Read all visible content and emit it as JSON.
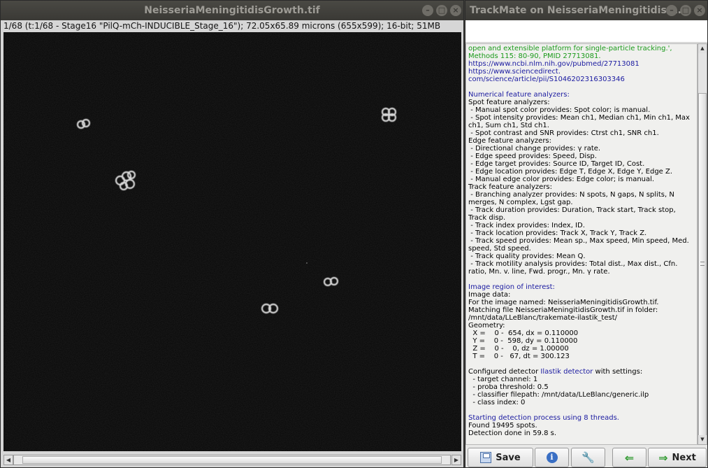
{
  "image_window": {
    "title": "NeisseriaMeningitidisGrowth.tif",
    "info": "1/68 (t:1/68 - Stage16 \"PilQ-mCh-INDUCIBLE_Stage_16\"); 72.05x65.89 microns (655x599); 16-bit; 51MB"
  },
  "trackmate_window": {
    "title": "TrackMate on NeisseriaMeningitidisG…",
    "log": [
      {
        "text": "open and extensible platform for single-particle tracking.', Methods 115: 80-90, PMID 27713081.",
        "color": "green"
      },
      {
        "text": "https://www.ncbi.nlm.nih.gov/pubmed/27713081",
        "color": "blue"
      },
      {
        "text": "https://www.sciencedirect.",
        "color": "blue"
      },
      {
        "text": "com/science/article/pii/S1046202316303346",
        "color": "blue"
      },
      {
        "text": "",
        "color": "gap"
      },
      {
        "text": "Numerical feature analyzers:",
        "color": "blue"
      },
      {
        "text": "Spot feature analyzers:",
        "color": "black"
      },
      {
        "text": " - Manual spot color provides: Spot color; is manual.",
        "color": "black"
      },
      {
        "text": " - Spot intensity provides: Mean ch1, Median ch1, Min ch1, Max ch1, Sum ch1, Std ch1.",
        "color": "black"
      },
      {
        "text": " - Spot contrast and SNR provides: Ctrst ch1, SNR ch1.",
        "color": "black"
      },
      {
        "text": "Edge feature analyzers:",
        "color": "black"
      },
      {
        "text": " - Directional change provides: γ rate.",
        "color": "black"
      },
      {
        "text": " - Edge speed provides: Speed, Disp.",
        "color": "black"
      },
      {
        "text": " - Edge target provides: Source ID, Target ID, Cost.",
        "color": "black"
      },
      {
        "text": " - Edge location provides: Edge T, Edge X, Edge Y, Edge Z.",
        "color": "black"
      },
      {
        "text": " - Manual edge color provides: Edge color; is manual.",
        "color": "black"
      },
      {
        "text": "Track feature analyzers:",
        "color": "black"
      },
      {
        "text": " - Branching analyzer provides: N spots, N gaps, N splits, N merges, N complex, Lgst gap.",
        "color": "black"
      },
      {
        "text": " - Track duration provides: Duration, Track start, Track stop, Track disp.",
        "color": "black"
      },
      {
        "text": " - Track index provides: Index, ID.",
        "color": "black"
      },
      {
        "text": " - Track location provides: Track X, Track Y, Track Z.",
        "color": "black"
      },
      {
        "text": " - Track speed provides: Mean sp., Max speed, Min speed, Med. speed, Std speed.",
        "color": "black"
      },
      {
        "text": " - Track quality provides: Mean Q.",
        "color": "black"
      },
      {
        "text": " - Track motility analysis provides: Total dist., Max dist., Cfn. ratio, Mn. v. line, Fwd. progr., Mn. γ rate.",
        "color": "black"
      },
      {
        "text": "",
        "color": "gap"
      },
      {
        "text": "Image region of interest:",
        "color": "blue"
      },
      {
        "text": "Image data:",
        "color": "black"
      },
      {
        "text": "For the image named: NeisseriaMeningitidisGrowth.tif.",
        "color": "black"
      },
      {
        "text": "Matching file NeisseriaMeningitidisGrowth.tif in folder: /mnt/data/LLeBlanc/trakemate-ilastik_test/",
        "color": "black"
      },
      {
        "text": "Geometry:",
        "color": "black"
      },
      {
        "text": "  X =    0 -  654, dx = 0.110000",
        "color": "black"
      },
      {
        "text": "  Y =    0 -  598, dy = 0.110000",
        "color": "black"
      },
      {
        "text": "  Z =    0 -    0, dz = 1.00000",
        "color": "black"
      },
      {
        "text": "  T =    0 -   67, dt = 300.123",
        "color": "black"
      },
      {
        "text": "",
        "color": "gap"
      },
      {
        "text": "Configured detector ",
        "color": "black",
        "link": "Ilastik detector",
        "after": " with settings:"
      },
      {
        "text": "  - target channel: 1",
        "color": "black"
      },
      {
        "text": "  - proba threshold: 0.5",
        "color": "black"
      },
      {
        "text": "  - classifier filepath: /mnt/data/LLeBlanc/generic.ilp",
        "color": "black"
      },
      {
        "text": "  - class index: 0",
        "color": "black"
      },
      {
        "text": "",
        "color": "gap"
      },
      {
        "text": "Starting detection process using 8 threads.",
        "color": "blue"
      },
      {
        "text": "Found 19495 spots.",
        "color": "black"
      },
      {
        "text": "Detection done in 59.8 s.",
        "color": "black"
      }
    ],
    "buttons": {
      "save": "Save",
      "next": "Next"
    }
  },
  "icons": {
    "save": "save-icon",
    "info": "info-icon",
    "wrench": "wrench-icon",
    "prev": "arrow-left-icon",
    "next": "arrow-right-icon"
  }
}
